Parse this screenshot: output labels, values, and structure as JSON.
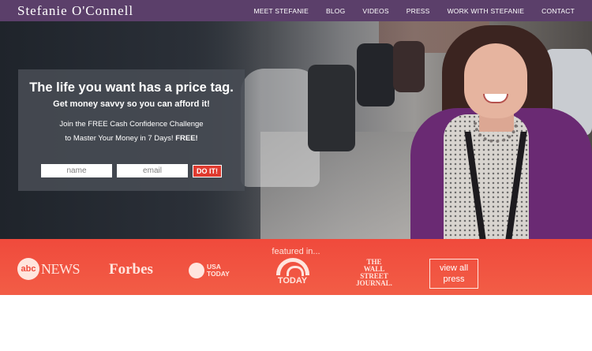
{
  "nav": {
    "brand": "Stefanie O'Connell",
    "items": [
      "MEET STEFANIE",
      "BLOG",
      "VIDEOS",
      "PRESS",
      "WORK WITH STEFANIE",
      "CONTACT"
    ]
  },
  "hero": {
    "headline": "The life you want has a price tag.",
    "subheadline": "Get money savvy so you can afford it!",
    "line1": "Join the FREE Cash Confidence Challenge",
    "line2": "to Master Your Money in 7 Days!",
    "free_label": "FREE!",
    "name_placeholder": "name",
    "email_placeholder": "email",
    "submit_label": "DO IT!"
  },
  "featured": {
    "label": "featured in...",
    "logos": {
      "abc_mark": "abc",
      "abc_word": "NEWS",
      "forbes": "Forbes",
      "usa_line1": "USA",
      "usa_line2": "TODAY",
      "today": "TODAY",
      "wsj_line1": "THE",
      "wsj_line2": "WALL STREET",
      "wsj_line3": "JOURNAL."
    },
    "press_button": "view all press"
  },
  "colors": {
    "nav_bg": "#5b3f6a",
    "featured_bg": "#f04a3c",
    "submit_bg": "#e03a2f"
  }
}
